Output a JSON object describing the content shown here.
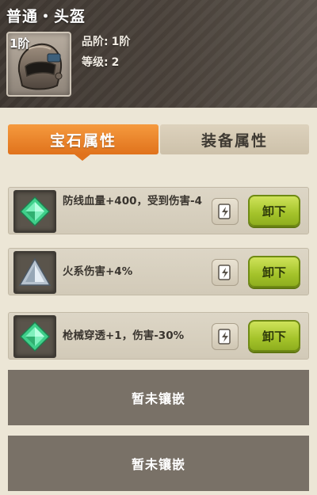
{
  "header": {
    "title": "普通・头盔",
    "tier_badge": "1阶",
    "stats": [
      {
        "key": "品阶:",
        "value": "1阶"
      },
      {
        "key": "等级:",
        "value": "2"
      }
    ]
  },
  "tabs": [
    {
      "label": "宝石属性",
      "active": true
    },
    {
      "label": "装备属性",
      "active": false
    }
  ],
  "gems": [
    {
      "icon": "green-gem-icon",
      "text": "防线血量+400，受到伤害-4",
      "button": "卸下"
    },
    {
      "icon": "triangle-gem-icon",
      "text": "火系伤害+4%",
      "button": "卸下"
    },
    {
      "icon": "green-gem-icon",
      "text": "枪械穿透+1，伤害-30%",
      "button": "卸下"
    }
  ],
  "empty_slots": [
    {
      "label": "暂未镶嵌"
    },
    {
      "label": "暂未镶嵌"
    }
  ],
  "colors": {
    "accent_orange": "#e8821f",
    "button_green": "#a4c32a",
    "header_dark": "#4a423b"
  }
}
